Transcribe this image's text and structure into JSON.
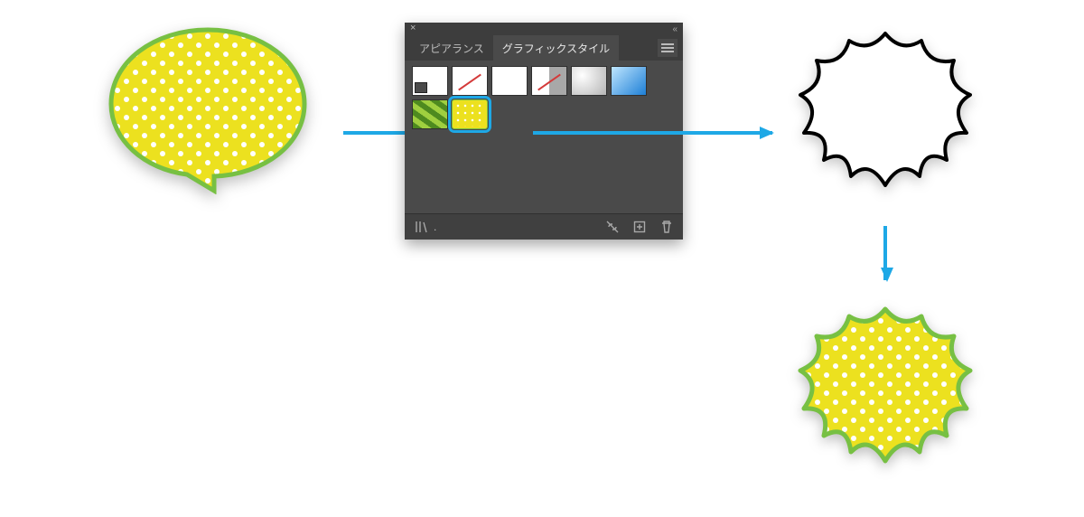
{
  "panel": {
    "tabs": {
      "appearance": "アピアランス",
      "graphic_styles": "グラフィックスタイル"
    },
    "styles_row1": [
      "default-fillstroke",
      "nofill-nostr",
      "white",
      "half",
      "soft-gradient",
      "blue-gradient"
    ],
    "styles_row2": [
      "green-stripes",
      "yellow-polkadot"
    ],
    "selected_style": "yellow-polkadot"
  },
  "icons": {
    "close": "×",
    "collapse": "«",
    "menu": "menu",
    "library": "library",
    "link_break": "break-link",
    "new": "new-style",
    "trash": "delete"
  },
  "style_applied": {
    "fill": "#ece11f",
    "stroke": "#77c043",
    "pattern": "white-polka-dots"
  }
}
